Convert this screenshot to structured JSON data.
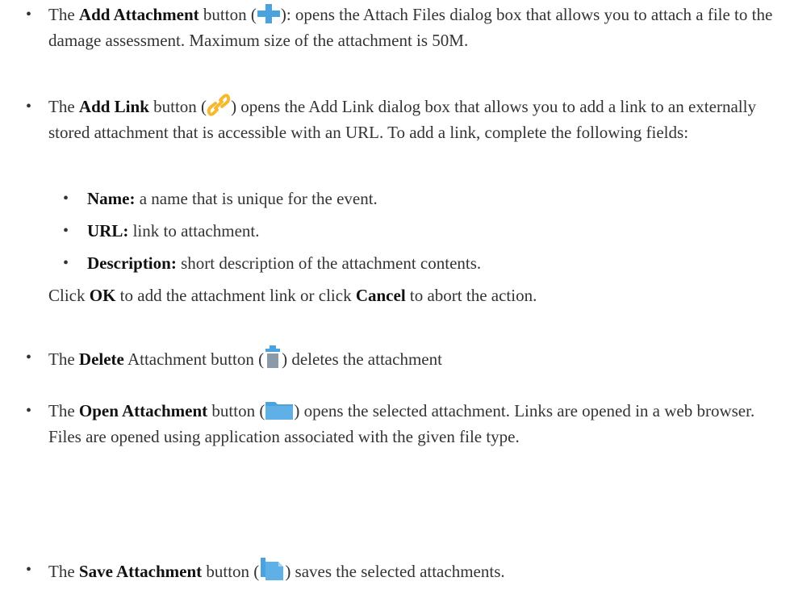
{
  "bullet_glyph": "•",
  "add_attachment": {
    "pre": "The ",
    "bold": "Add Attachment",
    "mid": " button (",
    "post": "): opens the Attach Files dialog box that allows you to attach a file to the damage assessment. Maximum size of the attachment is 50M.",
    "icon": "plus-icon"
  },
  "add_link": {
    "pre": "The ",
    "bold": "Add Link",
    "mid": " button (",
    "post": ") opens the Add Link dialog box that allows you to add a link to an externally stored attachment that is accessible with an URL. To add a link, complete the following fields:",
    "icon": "link-icon"
  },
  "fields": [
    {
      "label": "Name:",
      "text": " a name that is unique for the event."
    },
    {
      "label": "URL:",
      "text": " link to attachment."
    },
    {
      "label": "Description:",
      "text": " short description of the attachment contents."
    }
  ],
  "click_note": {
    "pre": "Click ",
    "ok": "OK",
    "mid": " to add the attachment link or click ",
    "cancel": "Cancel",
    "post": " to abort the action."
  },
  "delete_attachment": {
    "pre": "The ",
    "bold": "Delete",
    "mid": " Attachment button (",
    "post": ") deletes the attachment",
    "icon": "trash-icon"
  },
  "open_attachment": {
    "pre": "The ",
    "bold": "Open Attachment",
    "mid": " button (",
    "post": ") opens the selected attachment. Links are opened in a web browser. Files are opened using application associated with the given file type.",
    "icon": "folder-icon"
  },
  "save_attachment": {
    "pre": "The ",
    "bold": "Save Attachment",
    "mid": " button (",
    "post": ") saves the selected attachments.",
    "icon": "save-files-icon"
  },
  "colors": {
    "text": "#333333",
    "icon_blue": "#4aa3df",
    "icon_gold": "#f5b82e",
    "icon_gray": "#8a9aa8"
  }
}
